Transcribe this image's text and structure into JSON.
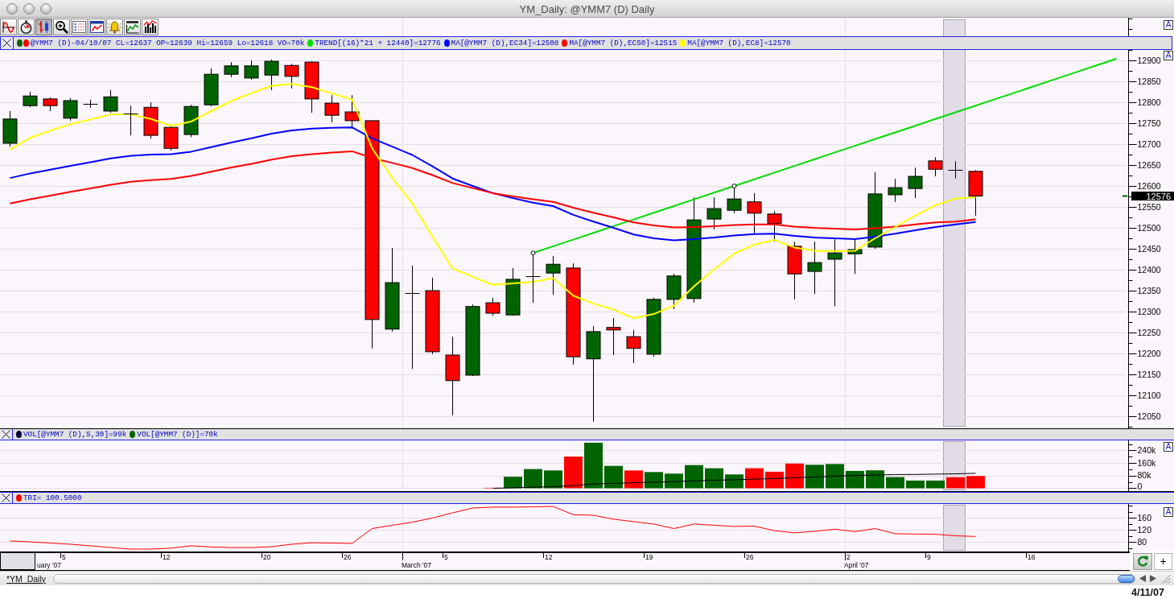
{
  "window": {
    "title": "YM_Daily: @YMM7 (D) Daily"
  },
  "toolbar": [
    {
      "kind": "wave",
      "selected": false
    },
    {
      "kind": "stopwatch",
      "selected": false
    },
    {
      "kind": "candles",
      "selected": true
    },
    {
      "kind": "zoom",
      "selected": false
    },
    {
      "kind": "list",
      "selected": false
    },
    {
      "kind": "chart",
      "selected": false
    },
    {
      "kind": "bell",
      "selected": false
    },
    {
      "kind": "title",
      "selected": false
    },
    {
      "kind": "histogram",
      "selected": false
    }
  ],
  "price_panel": {
    "legend": [
      {
        "dots": [
          {
            "color": "#006400"
          },
          {
            "color": "#ff0000"
          }
        ],
        "text": "@YMM7 (D)-04/10/07 CL=12637 OP=12639 Hi=12659 Lo=12618 VO=70k"
      },
      {
        "dots": [
          {
            "color": "#00dd00"
          }
        ],
        "text": "TREND[(16)*21 + 12440]=12776"
      },
      {
        "dots": [
          {
            "color": "#0000ff"
          }
        ],
        "text": "MA[@YMM7 (D),EC34]=12508"
      },
      {
        "dots": [
          {
            "color": "#ff0000"
          }
        ],
        "text": "MA[@YMM7 (D),EC50]=12515"
      },
      {
        "dots": [
          {
            "color": "#ffff00"
          }
        ],
        "text": "MA[@YMM7 (D),EC8]=12570"
      }
    ],
    "autoscale_buttons": [
      "A",
      "A"
    ],
    "last_price_tag": "12576",
    "chart_data": {
      "type": "line",
      "grid": true,
      "categories": [
        null,
        null,
        null,
        null,
        null,
        null,
        null,
        null,
        null,
        null,
        null,
        null,
        null,
        null,
        null,
        null,
        null,
        null,
        null,
        null,
        null,
        null,
        null,
        null,
        null,
        null,
        null,
        null,
        null,
        null,
        null,
        null,
        null,
        null,
        null,
        null,
        null,
        null,
        null,
        null,
        null,
        null,
        null,
        null,
        null,
        null,
        null,
        null,
        null,
        null,
        null,
        null,
        null,
        null,
        null,
        null
      ],
      "ylim": [
        12021,
        13004
      ],
      "yticks": [
        12050,
        12100,
        12150,
        12200,
        12250,
        12300,
        12350,
        12400,
        12450,
        12500,
        12550,
        12600,
        12650,
        12700,
        12750,
        12800,
        12850,
        12900
      ],
      "series": [
        {
          "color": "#00dd00",
          "values": [
            null,
            null,
            null,
            null,
            null,
            null,
            null,
            null,
            null,
            null,
            null,
            null,
            null,
            null,
            null,
            null,
            null,
            null,
            null,
            null,
            null,
            null,
            null,
            null,
            null,
            null,
            12440,
            12456,
            12472,
            12488,
            12504,
            12520,
            12536,
            12552,
            12568,
            12584,
            12600,
            12616,
            12632,
            12648,
            12664,
            12680,
            12696,
            12712,
            12728,
            12744,
            12760,
            12776,
            12792,
            12808,
            12824,
            12840,
            12856,
            12872,
            12888,
            12904
          ]
        },
        {
          "color": "#0000ff",
          "values": [
            12619,
            12630,
            12639,
            12648,
            12657,
            12666,
            12672,
            12675,
            12676,
            12682,
            12693,
            12704,
            12714,
            12725,
            12733,
            12737,
            12739,
            12740,
            12714,
            12694,
            12674,
            12647,
            12618,
            12600,
            12583,
            12571,
            12560,
            12552,
            12531,
            12515,
            12500,
            12484,
            12475,
            12470,
            12473,
            12477,
            12482,
            12485,
            12486,
            12481,
            12477,
            12475,
            12473,
            12479,
            12486,
            12494,
            12502,
            12508,
            12514,
            null,
            null,
            null,
            null,
            null,
            null,
            null
          ]
        },
        {
          "color": "#ff0000",
          "values": [
            12558,
            12568,
            12577,
            12586,
            12594,
            12603,
            12610,
            12614,
            12617,
            12624,
            12634,
            12644,
            12653,
            12663,
            12671,
            12676,
            12680,
            12683,
            12667,
            12655,
            12643,
            12626,
            12607,
            12595,
            12583,
            12575,
            12568,
            12562,
            12548,
            12536,
            12525,
            12513,
            12506,
            12501,
            12502,
            12504,
            12507,
            12508,
            12508,
            12503,
            12500,
            12498,
            12496,
            12499,
            12503,
            12508,
            12513,
            12515,
            12520,
            null,
            null,
            null,
            null,
            null,
            null,
            null
          ]
        },
        {
          "color": "#ffff00",
          "values": [
            12687,
            12715,
            12732,
            12748,
            12759,
            12771,
            12771,
            12760,
            12744,
            12754,
            12779,
            12803,
            12822,
            12839,
            12844,
            12836,
            12821,
            12807,
            12690,
            12619,
            12558,
            12479,
            12403,
            12383,
            12364,
            12367,
            12371,
            12380,
            12338,
            12319,
            12305,
            12284,
            12294,
            12314,
            12360,
            12401,
            12438,
            12460,
            12471,
            12453,
            12445,
            12444,
            12445,
            12475,
            12502,
            12529,
            12554,
            12570,
            12573,
            null,
            null,
            null,
            null,
            null,
            null,
            null
          ]
        }
      ]
    }
  },
  "volume_panel": {
    "legend": [
      {
        "dots": [
          {
            "color": "#000033"
          }
        ],
        "text": "VOL[@YMM7 (D),S,30]=99k"
      },
      {
        "dots": [
          {
            "color": "#006400"
          }
        ],
        "text": "VOL[@YMM7 (D)]=70k"
      }
    ],
    "autoscale_button": "A",
    "chart_data": {
      "type": "bar",
      "stacked": true,
      "grid": true,
      "categories": [
        null,
        null,
        null,
        null,
        null,
        null,
        null,
        null,
        null,
        null,
        null,
        null,
        null,
        null,
        null,
        null,
        null,
        null,
        null,
        null,
        null,
        null,
        null,
        null,
        null,
        null,
        null,
        null,
        null,
        null,
        null,
        null,
        null,
        null,
        null,
        null,
        null,
        null,
        null,
        null,
        null,
        null,
        null,
        null,
        null,
        null,
        null,
        null,
        null,
        null,
        null,
        null,
        null,
        null,
        null,
        null
      ],
      "ylim": [
        -17900,
        308900
      ],
      "yticks": [
        {
          "value": 0,
          "label": "0"
        },
        {
          "value": 80000,
          "label": "80k"
        },
        {
          "value": 160000,
          "label": "160k"
        },
        {
          "value": 240000,
          "label": "240k"
        }
      ],
      "series": [
        {
          "color": "#006400",
          "values": [
            null,
            null,
            null,
            null,
            null,
            null,
            null,
            null,
            null,
            null,
            null,
            null,
            null,
            null,
            null,
            null,
            null,
            null,
            null,
            null,
            null,
            null,
            null,
            null,
            null,
            73000,
            122000,
            113000,
            null,
            289000,
            142000,
            null,
            103000,
            93000,
            147000,
            127000,
            88000,
            null,
            null,
            null,
            149000,
            154000,
            110000,
            114000,
            71000,
            49000,
            49000,
            null,
            null,
            null,
            null,
            null,
            null,
            null,
            null,
            null
          ]
        },
        {
          "color": "#ff0000",
          "values": [
            null,
            null,
            null,
            null,
            null,
            null,
            null,
            null,
            null,
            null,
            null,
            null,
            null,
            null,
            null,
            null,
            null,
            null,
            null,
            null,
            null,
            null,
            null,
            null,
            3000,
            null,
            null,
            null,
            201000,
            null,
            null,
            113000,
            null,
            null,
            null,
            null,
            null,
            127000,
            105000,
            157000,
            null,
            null,
            null,
            null,
            null,
            null,
            null,
            70000,
            78000,
            null,
            null,
            null,
            null,
            null,
            null,
            null
          ]
        },
        {
          "type": "line",
          "color": "#000000",
          "values": [
            null,
            null,
            null,
            null,
            null,
            null,
            null,
            null,
            null,
            null,
            null,
            null,
            null,
            null,
            null,
            null,
            null,
            null,
            null,
            null,
            null,
            null,
            null,
            null,
            0,
            3000,
            7000,
            10000,
            17000,
            27000,
            31000,
            35000,
            39000,
            42000,
            47000,
            51000,
            54000,
            58000,
            62000,
            67000,
            72000,
            77000,
            81000,
            84000,
            87000,
            88000,
            90000,
            92000,
            95000,
            null,
            null,
            null,
            null,
            null,
            null,
            null
          ]
        }
      ]
    }
  },
  "tri_panel": {
    "legend": [
      {
        "dots": [
          {
            "color": "#ff0000"
          }
        ],
        "text": "TRI= 100.5000"
      }
    ],
    "autoscale_button": "A",
    "chart_data": {
      "type": "line",
      "grid": true,
      "categories": [
        null,
        null,
        null,
        null,
        null,
        null,
        null,
        null,
        null,
        null,
        null,
        null,
        null,
        null,
        null,
        null,
        null,
        null,
        null,
        null,
        null,
        null,
        null,
        null,
        null,
        null,
        null,
        null,
        null,
        null,
        null,
        null,
        null,
        null,
        null,
        null,
        null,
        null,
        null,
        null,
        null,
        null,
        null,
        null,
        null,
        null,
        null,
        null,
        null,
        null,
        null,
        null,
        null,
        null,
        null,
        null
      ],
      "ylim": [
        48,
        208
      ],
      "yticks": [
        80,
        120,
        160
      ],
      "series": [
        {
          "color": "#ff0000",
          "values": [
            83,
            80,
            76,
            72,
            67,
            61,
            56,
            56,
            59,
            67,
            63,
            61,
            61,
            64,
            72,
            77,
            76,
            75,
            124,
            135,
            145,
            159,
            176,
            192,
            195,
            195,
            196,
            197,
            170,
            168,
            155,
            147,
            139,
            124,
            139,
            135,
            131,
            132,
            117,
            110,
            115,
            122,
            114,
            124,
            107,
            106,
            105,
            100,
            98,
            null,
            null,
            null,
            null,
            null,
            null,
            null
          ]
        }
      ]
    }
  },
  "date_axis": {
    "day_labels": [
      "5",
      "12",
      "20",
      "26",
      "5",
      "12",
      "19",
      "26",
      "2",
      "9",
      "16"
    ],
    "month_labels": [
      "uary '07",
      "March '07",
      "April '07"
    ]
  },
  "bottom_bar": {
    "tab": "*YM_Daily",
    "add_button": "+"
  },
  "date_stamp": "4/11/07"
}
